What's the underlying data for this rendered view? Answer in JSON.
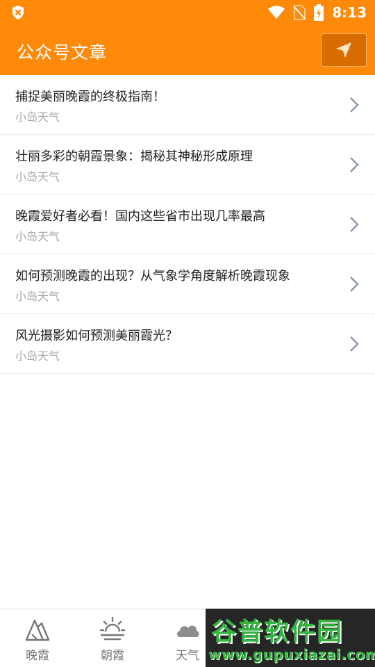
{
  "status_bar": {
    "time": "8:13"
  },
  "header": {
    "title": "公众号文章"
  },
  "articles": [
    {
      "title": "捕捉美丽晚霞的终极指南！",
      "source": "小岛天气"
    },
    {
      "title": "壮丽多彩的朝霞景象：揭秘其神秘形成原理",
      "source": "小岛天气"
    },
    {
      "title": "晚霞爱好者必看！国内这些省市出现几率最高",
      "source": "小岛天气"
    },
    {
      "title": "如何预测晚霞的出现？从气象学角度解析晚霞现象",
      "source": "小岛天气"
    },
    {
      "title": "风光摄影如何预测美丽霞光？",
      "source": "小岛天气"
    }
  ],
  "bottom_nav": [
    {
      "label": "晚霞",
      "icon": "mountain-icon"
    },
    {
      "label": "朝霞",
      "icon": "sunrise-icon"
    },
    {
      "label": "天气",
      "icon": "cloud-icon"
    }
  ],
  "watermark": {
    "brand": "谷普软件园",
    "url": "www.gupuxiazai.com"
  },
  "colors": {
    "accent": "#FF8A0A",
    "accent_dark": "#D96C00",
    "watermark_green": "#34B341"
  }
}
